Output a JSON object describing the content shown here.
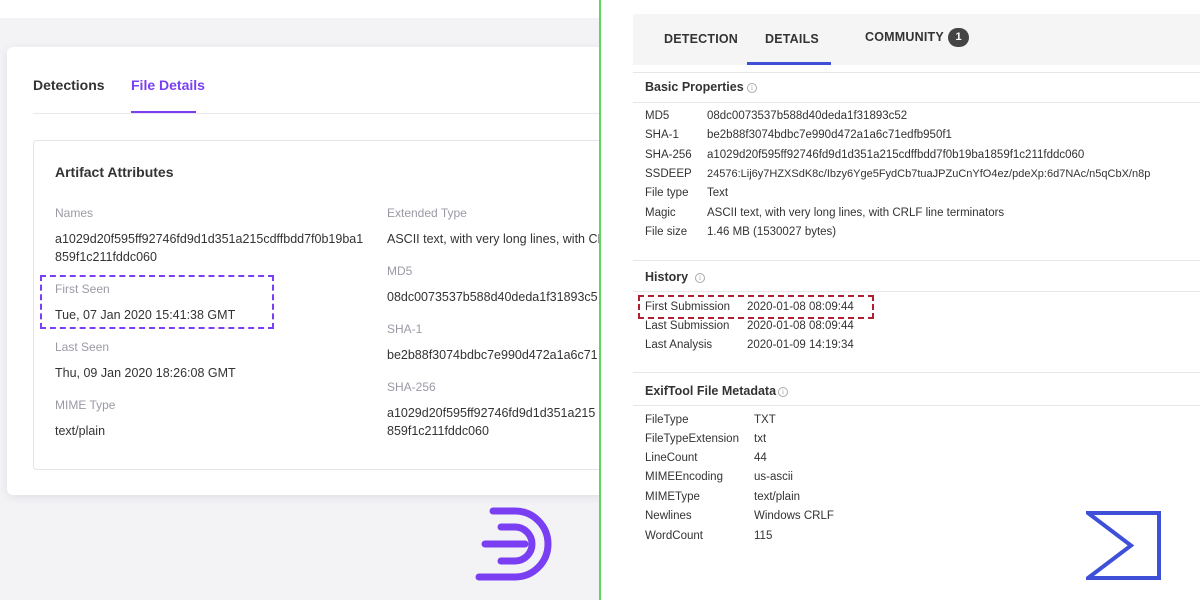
{
  "left": {
    "tabs": [
      {
        "label": "Detections"
      },
      {
        "label": "File Details"
      }
    ],
    "artifact_title": "Artifact Attributes",
    "names_label": "Names",
    "names_line1": "a1029d20f595ff92746fd9d1d351a215cdffbdd7f0b19ba1",
    "names_line2": "859f1c211fddc060",
    "first_seen_label": "First Seen",
    "first_seen_value": "Tue, 07 Jan 2020 15:41:38 GMT",
    "last_seen_label": "Last Seen",
    "last_seen_value": "Thu, 09 Jan 2020 18:26:08 GMT",
    "mime_label": "MIME Type",
    "mime_value": "text/plain",
    "ext_type_label": "Extended Type",
    "ext_type_value": "ASCII text, with very long lines, with CR",
    "md5_label": "MD5",
    "md5_value": "08dc0073537b588d40deda1f31893c5",
    "sha1_label": "SHA-1",
    "sha1_value": "be2b88f3074bdbc7e990d472a1a6c71",
    "sha256_label": "SHA-256",
    "sha256_line1": "a1029d20f595ff92746fd9d1d351a215",
    "sha256_line2": "859f1c211fddc060"
  },
  "right": {
    "tabs": {
      "detection": "DETECTION",
      "details": "DETAILS",
      "community": "COMMUNITY",
      "community_count": "1"
    },
    "basic_properties": {
      "title": "Basic Properties",
      "rows": [
        {
          "key": "MD5",
          "value": "08dc0073537b588d40deda1f31893c52"
        },
        {
          "key": "SHA-1",
          "value": "be2b88f3074bdbc7e990d472a1a6c71edfb950f1"
        },
        {
          "key": "SHA-256",
          "value": "a1029d20f595ff92746fd9d1d351a215cdffbdd7f0b19ba1859f1c211fddc060"
        },
        {
          "key": "SSDEEP",
          "value": "24576:Lij6y7HZXSdK8c/Ibzy6Yge5FydCb7tuaJPZuCnYfO4ez/pdeXp:6d7NAc/n5qCbX/n8p"
        },
        {
          "key": "File type",
          "value": "Text"
        },
        {
          "key": "Magic",
          "value": "ASCII text, with very long lines, with CRLF line terminators"
        },
        {
          "key": "File size",
          "value": "1.46 MB (1530027 bytes)"
        }
      ]
    },
    "history": {
      "title": "History",
      "rows": [
        {
          "key": "First Submission",
          "value": "2020-01-08 08:09:44"
        },
        {
          "key": "Last Submission",
          "value": "2020-01-08 08:09:44"
        },
        {
          "key": "Last Analysis",
          "value": "2020-01-09 14:19:34"
        }
      ]
    },
    "exiftool": {
      "title": "ExifTool File Metadata",
      "rows": [
        {
          "key": "FileType",
          "value": "TXT"
        },
        {
          "key": "FileTypeExtension",
          "value": "txt"
        },
        {
          "key": "LineCount",
          "value": "44"
        },
        {
          "key": "MIMEEncoding",
          "value": "us-ascii"
        },
        {
          "key": "MIMEType",
          "value": "text/plain"
        },
        {
          "key": "Newlines",
          "value": "Windows CRLF"
        },
        {
          "key": "WordCount",
          "value": "115"
        }
      ]
    }
  },
  "colors": {
    "left_accent": "#7a3ff2",
    "right_accent": "#3e50d8",
    "highlight_red": "#b01f2f",
    "divider_green": "#5cd65c"
  },
  "icons": [
    "info-icon",
    "d-brand-logo-icon",
    "sigma-brand-logo-icon"
  ]
}
